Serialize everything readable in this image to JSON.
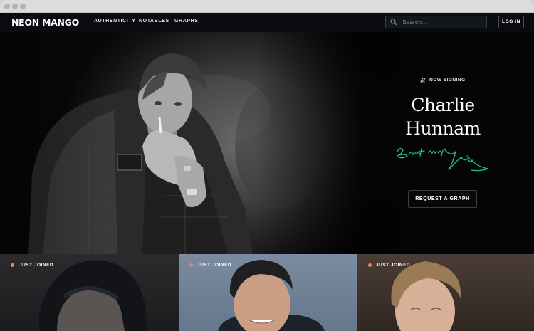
{
  "nav": {
    "logo": "NEON MANGO",
    "links": [
      "AUTHENTICITY",
      "NOTABLES",
      "GRAPHS"
    ],
    "search_placeholder": "Search...",
    "login_label": "LOG IN"
  },
  "hero": {
    "eyebrow": "NOW SIGNING",
    "name_line1": "Charlie",
    "name_line2": "Hunnam",
    "signature_text": "Best wishes",
    "cta_label": "REQUEST A GRAPH"
  },
  "cards": [
    {
      "label": "JUST JOINED"
    },
    {
      "label": "JUST JOINED"
    },
    {
      "label": "JUST JOINED"
    }
  ],
  "colors": {
    "accent": "#e8895a",
    "signature": "#1fbf86",
    "nav_bg": "#0a0b10"
  }
}
